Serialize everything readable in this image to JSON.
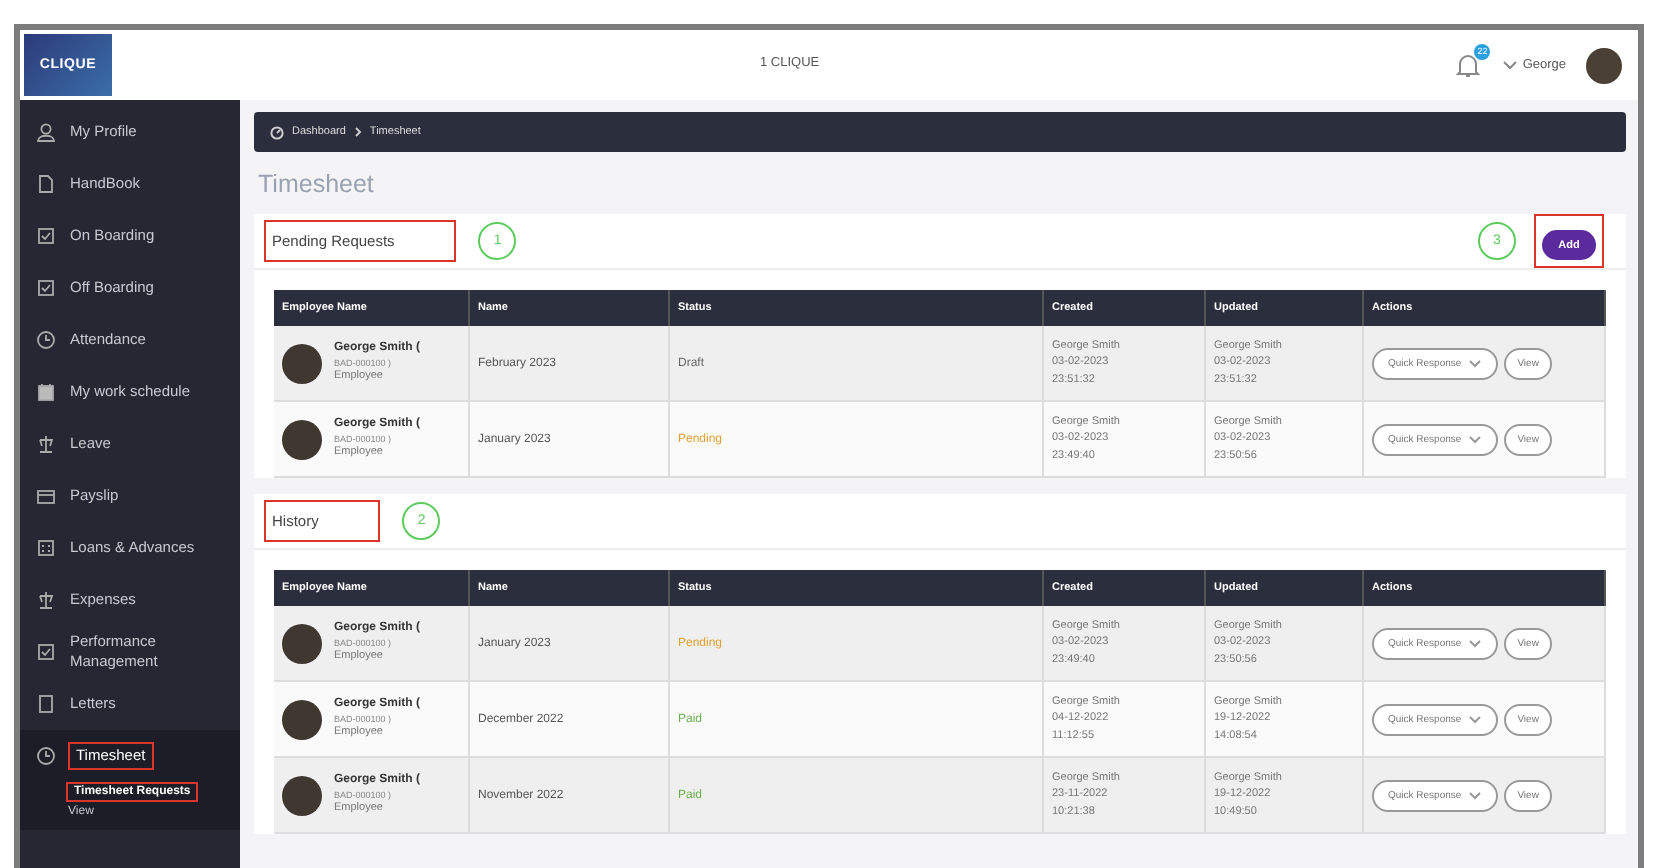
{
  "header": {
    "logo": "CLIQUE",
    "title": "1 CLIQUE",
    "notifications": "22",
    "user": "George"
  },
  "sidebar": {
    "items": [
      {
        "label": "My Profile",
        "selected": false,
        "highlighted": false
      },
      {
        "label": "HandBook",
        "selected": false,
        "highlighted": false
      },
      {
        "label": "On Boarding",
        "selected": false,
        "highlighted": false
      },
      {
        "label": "Off Boarding",
        "selected": false,
        "highlighted": false
      },
      {
        "label": "Attendance",
        "selected": false,
        "highlighted": false
      },
      {
        "label": "My work schedule",
        "selected": false,
        "highlighted": false
      },
      {
        "label": "Leave",
        "selected": false,
        "highlighted": false
      },
      {
        "label": "Payslip",
        "selected": false,
        "highlighted": false
      },
      {
        "label": "Loans & Advances",
        "selected": false,
        "highlighted": false
      },
      {
        "label": "Expenses",
        "selected": false,
        "highlighted": false
      },
      {
        "label": "Performance Management",
        "selected": false,
        "highlighted": false
      },
      {
        "label": "Letters",
        "selected": false,
        "highlighted": false
      },
      {
        "label": "Timesheet",
        "selected": true,
        "highlighted": true,
        "expanded": true,
        "children": [
          {
            "label": "Timesheet Requests",
            "selected": true,
            "highlighted": true
          },
          {
            "label": "View",
            "selected": false,
            "highlighted": false
          }
        ]
      }
    ]
  },
  "breadcrumb": [
    "Dashboard",
    "Timesheet"
  ],
  "page_title": "Timesheet",
  "panels": [
    {
      "title": "Pending Requests",
      "highlighted": true,
      "callout": "1",
      "add_button": {
        "label": "Add",
        "highlighted": true,
        "callout": "3"
      },
      "columns": [
        "Employee Name",
        "Name",
        "Status",
        "Created",
        "Updated",
        "Actions"
      ],
      "rows": [
        {
          "employee": "George Smith (",
          "employee_id": "BAD-000100 )",
          "role": "Employee",
          "name": "February 2023",
          "status": {
            "text": "Draft",
            "kind": "draft"
          },
          "created": [
            "George Smith",
            "03-02-2023",
            "23:51:32"
          ],
          "updated": [
            "George Smith",
            "03-02-2023",
            "23:51:32"
          ],
          "actions": [
            "Quick Response",
            "View"
          ]
        },
        {
          "employee": "George Smith (",
          "employee_id": "BAD-000100 )",
          "role": "Employee",
          "name": "January 2023",
          "status": {
            "text": "Pending",
            "kind": "pending"
          },
          "created": [
            "George Smith",
            "03-02-2023",
            "23:49:40"
          ],
          "updated": [
            "George Smith",
            "03-02-2023",
            "23:50:56"
          ],
          "actions": [
            "Quick Response",
            "View"
          ]
        }
      ]
    },
    {
      "title": "History",
      "highlighted": true,
      "callout": "2",
      "columns": [
        "Employee Name",
        "Name",
        "Status",
        "Created",
        "Updated",
        "Actions"
      ],
      "rows": [
        {
          "employee": "George Smith (",
          "employee_id": "BAD-000100 )",
          "role": "Employee",
          "name": "January 2023",
          "status": {
            "text": "Pending",
            "kind": "pending"
          },
          "created": [
            "George Smith",
            "03-02-2023",
            "23:49:40"
          ],
          "updated": [
            "George Smith",
            "03-02-2023",
            "23:50:56"
          ],
          "actions": [
            "Quick Response",
            "View"
          ]
        },
        {
          "employee": "George Smith (",
          "employee_id": "BAD-000100 )",
          "role": "Employee",
          "name": "December 2022",
          "status": {
            "text": "Paid",
            "kind": "paid"
          },
          "created": [
            "George Smith",
            "04-12-2022",
            "11:12:55"
          ],
          "updated": [
            "George Smith",
            "19-12-2022",
            "14:08:54"
          ],
          "actions": [
            "Quick Response",
            "View"
          ]
        },
        {
          "employee": "George Smith (",
          "employee_id": "BAD-000100 )",
          "role": "Employee",
          "name": "November 2022",
          "status": {
            "text": "Paid",
            "kind": "paid"
          },
          "created": [
            "George Smith",
            "23-11-2022",
            "10:21:38"
          ],
          "updated": [
            "George Smith",
            "19-12-2022",
            "10:49:50"
          ],
          "actions": [
            "Quick Response",
            "View"
          ]
        }
      ]
    }
  ]
}
